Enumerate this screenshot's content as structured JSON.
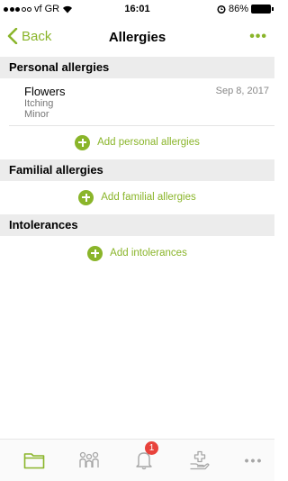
{
  "status_bar": {
    "carrier": "vf GR",
    "time": "16:01",
    "battery": "86%"
  },
  "nav": {
    "back_label": "Back",
    "title": "Allergies",
    "more_label": "•••"
  },
  "sections": {
    "personal": {
      "header": "Personal allergies",
      "items": [
        {
          "name": "Flowers",
          "reaction": "Itching",
          "severity": "Minor",
          "date": "Sep 8, 2017"
        }
      ],
      "add_label": "Add personal allergies"
    },
    "familial": {
      "header": "Familial allergies",
      "add_label": "Add familial allergies"
    },
    "intolerances": {
      "header": "Intolerances",
      "add_label": "Add intolerances"
    }
  },
  "tab_bar": {
    "notification_badge": "1",
    "more_label": "•••"
  },
  "colors": {
    "accent": "#8ab52a",
    "section_bg": "#ececec",
    "badge": "#e8423b"
  }
}
